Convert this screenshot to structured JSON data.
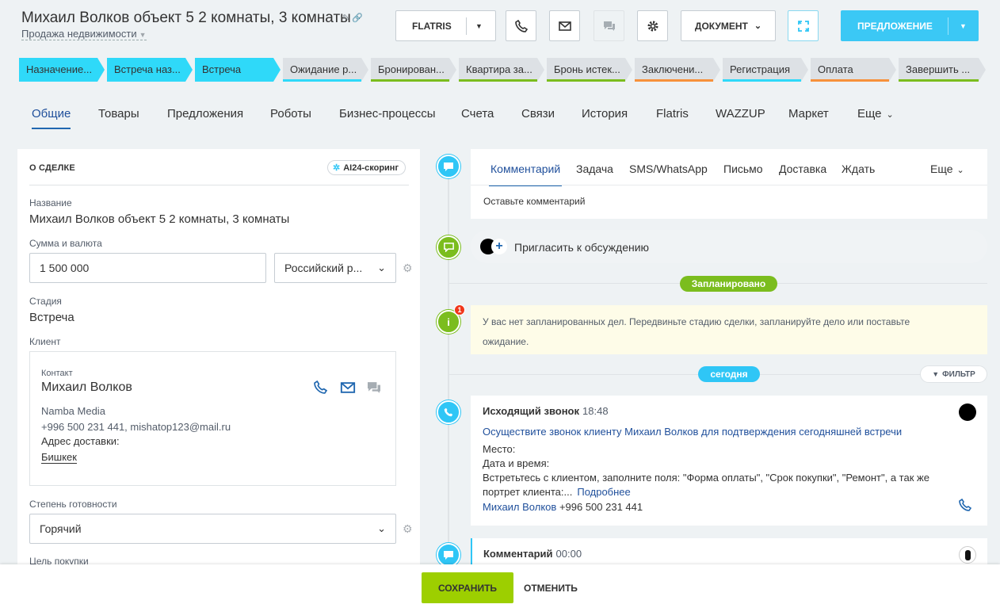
{
  "header": {
    "title": "Михаил Волков объект 5 2 комнаты, 3  комнаты",
    "subtitle": "Продажа недвижимости",
    "buttons": {
      "flatris": "FLATRIS",
      "document": "ДОКУМЕНТ",
      "offer": "ПРЕДЛОЖЕНИЕ"
    }
  },
  "stages": [
    {
      "label": "Назначение...",
      "bg": "#2fd9f9",
      "bar": "#2fd9f9"
    },
    {
      "label": "Встреча наз...",
      "bg": "#2fd9f9",
      "bar": "#2fd9f9"
    },
    {
      "label": "Встреча",
      "bg": "#2fd9f9",
      "bar": "#2fd9f9"
    },
    {
      "label": "Ожидание р...",
      "bg": "#dde1e5",
      "bar": "#2fd9f9"
    },
    {
      "label": "Бронирован...",
      "bg": "#dde1e5",
      "bar": "#7bbd1e"
    },
    {
      "label": "Квартира за...",
      "bg": "#dde1e5",
      "bar": "#7bbd1e"
    },
    {
      "label": "Бронь истек...",
      "bg": "#dde1e5",
      "bar": "#7bbd1e"
    },
    {
      "label": "Заключени...",
      "bg": "#dde1e5",
      "bar": "#f7913b"
    },
    {
      "label": "Регистрация",
      "bg": "#dde1e5",
      "bar": "#2fd9f9"
    },
    {
      "label": "Оплата",
      "bg": "#dde1e5",
      "bar": "#f7913b"
    },
    {
      "label": "Завершить ...",
      "bg": "#dde1e5",
      "bar": "#7bbd1e"
    }
  ],
  "tabs": [
    "Общие",
    "Товары",
    "Предложения",
    "Роботы",
    "Бизнес-процессы",
    "Счета",
    "Связи",
    "История",
    "Flatris",
    "WAZZUP",
    "Маркет",
    "Еще"
  ],
  "deal": {
    "section_title": "О СДЕЛКЕ",
    "ai_badge": "AI24-скоринг",
    "name_label": "Название",
    "name_value": "Михаил Волков объект 5 2 комнаты, 3 комнаты",
    "sum_label": "Сумма и валюта",
    "sum_value": "1 500 000",
    "currency_value": "Российский р...",
    "stage_label": "Стадия",
    "stage_value": "Встреча",
    "client_label": "Клиент",
    "client": {
      "type": "Контакт",
      "name": "Михаил Волков",
      "company": "Namba Media",
      "contacts": "+996 500 231 441, mishatop123@mail.ru",
      "address_label": "Адрес доставки:",
      "address": "Бишкек"
    },
    "readiness_label": "Степень готовности",
    "readiness_value": "Горячий",
    "purpose_label": "Цель покупки"
  },
  "timeline": {
    "comment_tabs": [
      "Комментарий",
      "Задача",
      "SMS/WhatsApp",
      "Письмо",
      "Доставка",
      "Ждать",
      "Еще"
    ],
    "comment_placeholder": "Оставьте комментарий",
    "invite": "Пригласить к обсуждению",
    "planned": "Запланировано",
    "notif_count": "1",
    "warning": "У вас нет запланированных дел. Передвиньте стадию сделки, запланируйте дело или поставьте ожидание.",
    "today": "сегодня",
    "filter": "ФИЛЬТР",
    "call": {
      "title": "Исходящий звонок",
      "time": "18:48",
      "subject": "Осуществите звонок клиенту Михаил Волков для подтверждения сегодняшней встречи",
      "place": "Место:",
      "datetime": "Дата и время:",
      "desc": "Встретьтесь с клиентом, заполните поля: \"Форма оплаты\", \"Срок покупки\", \"Ремонт\", а так же портрет клиента:...",
      "more": "Подробнее",
      "contact_name": "Михаил Волков",
      "contact_phone": "+996 500 231 441"
    },
    "comment2": {
      "title": "Комментарий",
      "time": "00:00"
    }
  },
  "footer": {
    "save": "СОХРАНИТЬ",
    "cancel": "ОТМЕНИТЬ"
  }
}
